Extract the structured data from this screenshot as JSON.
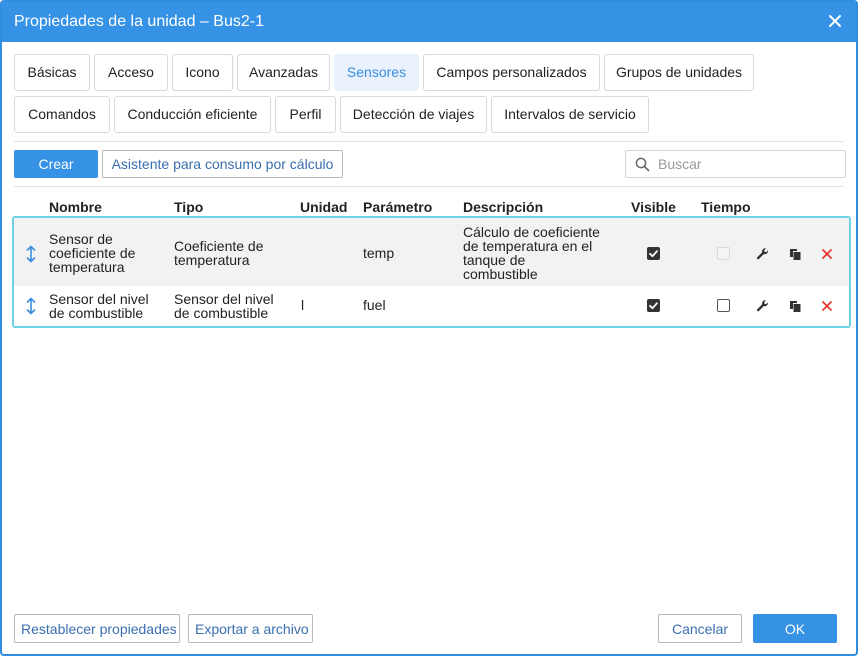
{
  "window": {
    "title": "Propiedades de la unidad – Bus2-1"
  },
  "tabs": [
    "Básicas",
    "Acceso",
    "Icono",
    "Avanzadas",
    "Sensores",
    "Campos personalizados",
    "Grupos de unidades",
    "Comandos",
    "Conducción eficiente",
    "Perfil",
    "Detección de viajes",
    "Intervalos de servicio"
  ],
  "active_tab": "Sensores",
  "toolbar": {
    "create_label": "Crear",
    "wizard_label": "Asistente para consumo por cálculo",
    "search_placeholder": "Buscar"
  },
  "table": {
    "columns": [
      "Nombre",
      "Tipo",
      "Unidad",
      "Parámetro",
      "Descripción",
      "Visible",
      "Tiempo"
    ],
    "rows": [
      {
        "name": [
          "Sensor de",
          "coeficiente de",
          "temperatura"
        ],
        "type": [
          "Coeficiente de",
          "temperatura"
        ],
        "unit": "",
        "param": "temp",
        "desc": [
          "Cálculo de coeficiente",
          "de temperatura en el",
          "tanque de",
          "combustible"
        ],
        "visible": true,
        "time": "disabled"
      },
      {
        "name": [
          "Sensor del nivel",
          "de combustible"
        ],
        "type": [
          "Sensor del nivel",
          "de combustible"
        ],
        "unit": "l",
        "param": "fuel",
        "desc": [],
        "visible": true,
        "time": "unchecked"
      }
    ]
  },
  "footer": {
    "reset_label": "Restablecer propiedades",
    "export_label": "Exportar a archivo",
    "cancel_label": "Cancelar",
    "ok_label": "OK"
  },
  "colors": {
    "accent": "#3592e5",
    "selection_border": "#6fd0e6",
    "delete": "#e53935"
  }
}
